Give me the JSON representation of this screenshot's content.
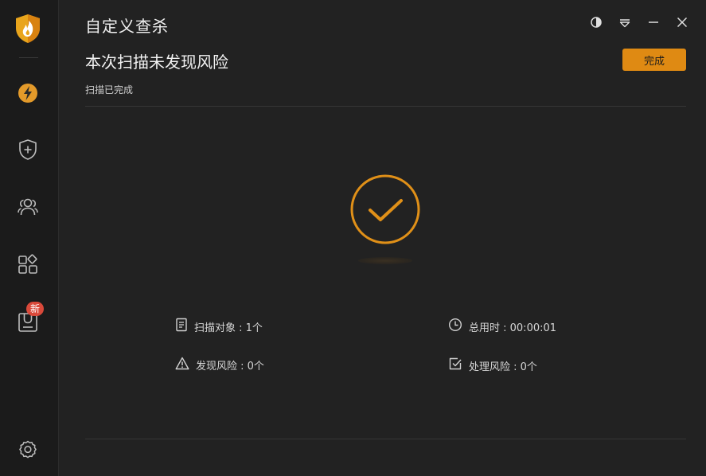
{
  "app": {
    "title": "自定义查杀"
  },
  "sidebar": {
    "items": [
      {
        "name": "speed"
      },
      {
        "name": "protection"
      },
      {
        "name": "users"
      },
      {
        "name": "apps"
      },
      {
        "name": "store",
        "badge": "新"
      }
    ]
  },
  "scan": {
    "heading": "本次扫描未发现风险",
    "status": "扫描已完成",
    "done_label": "完成"
  },
  "stats": {
    "scanned": "扫描对象 : 1个",
    "elapsed": "总用时 : 00:00:01",
    "found": "发现风险 : 0个",
    "handled": "处理风险 : 0个"
  },
  "colors": {
    "accent": "#df8a13",
    "badge": "#d9493a",
    "background": "#222222",
    "sidebar": "#1b1b1b"
  }
}
